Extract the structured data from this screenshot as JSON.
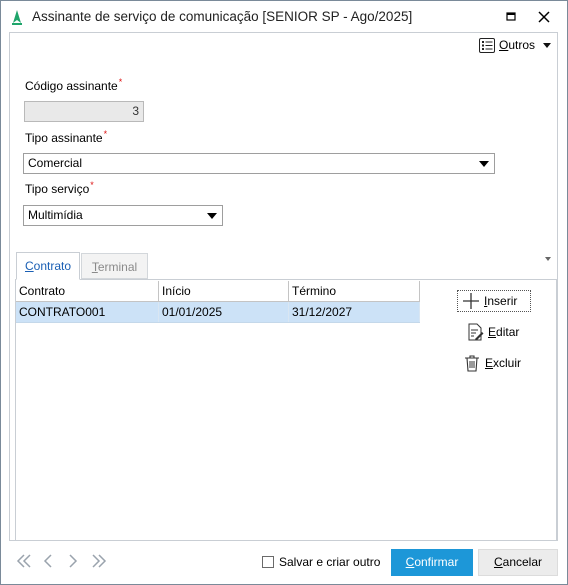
{
  "window": {
    "title": "Assinante de serviço de comunicação [SENIOR SP - Ago/2025]"
  },
  "toolbar": {
    "outros_first": "O",
    "outros_rest": "utros"
  },
  "form": {
    "codigo_label": "Código assinante",
    "codigo_value": "3",
    "tipo_assinante_label": "Tipo assinante",
    "tipo_assinante_value": "Comercial",
    "tipo_servico_label": "Tipo serviço",
    "tipo_servico_value": "Multimídia",
    "required_mark": "*"
  },
  "tabs": [
    {
      "first": "C",
      "rest": "ontrato",
      "active": true
    },
    {
      "first": "T",
      "rest": "erminal",
      "active": false
    }
  ],
  "grid": {
    "columns": [
      "Contrato",
      "Início",
      "Término"
    ],
    "rows": [
      [
        "CONTRATO001",
        "01/01/2025",
        "31/12/2027"
      ]
    ]
  },
  "actions": {
    "inserir_first": "I",
    "inserir_rest": "nserir",
    "editar_first": "E",
    "editar_rest": "ditar",
    "excluir_first": "E",
    "excluir_rest": "xcluir"
  },
  "footer": {
    "save_new_label": "Salvar e criar outro",
    "confirm_first": "C",
    "confirm_rest": "onfirmar",
    "cancel_first": "C",
    "cancel_rest": "ancelar"
  },
  "colors": {
    "primary_button": "#1d97d8",
    "selected_row": "#cce2f7",
    "required": "#dd1111",
    "active_tab_text": "#1a5fb4"
  }
}
